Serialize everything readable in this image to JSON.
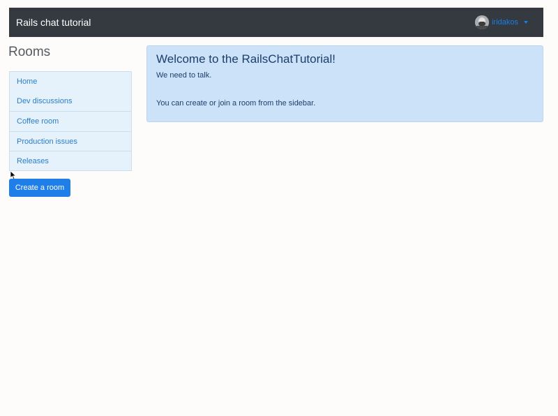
{
  "navbar": {
    "brand": "Rails chat tutorial",
    "user": {
      "name": "iridakos",
      "avatar_icon": "user-avatar",
      "caret_icon": "caret-down-icon"
    }
  },
  "sidebar": {
    "title": "Rooms",
    "rooms": [
      {
        "label": "Home"
      },
      {
        "label": "Dev discussions"
      },
      {
        "label": "Coffee room"
      },
      {
        "label": "Production issues"
      },
      {
        "label": "Releases"
      }
    ],
    "create_button": "Create a room"
  },
  "alert": {
    "heading": "Welcome to the RailsChatTutorial!",
    "line1": "We need to talk.",
    "line2": "You can create or join a room from the sidebar."
  },
  "colors": {
    "navbar_bg": "#343a40",
    "link": "#1a7ee6",
    "button_primary": "#1f7ee8",
    "alert_bg": "#cce2f9",
    "list_bg": "#e5f2fb"
  }
}
